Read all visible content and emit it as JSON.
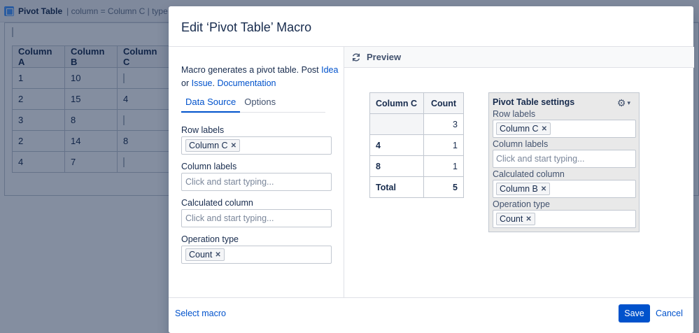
{
  "background": {
    "header": {
      "title": "Pivot Table",
      "params": "| column = Column C | type ="
    },
    "table": {
      "headers": [
        "Column A",
        "Column B",
        "Column C"
      ],
      "rows": [
        [
          "1",
          "10",
          ""
        ],
        [
          "2",
          "15",
          "4"
        ],
        [
          "3",
          "8",
          ""
        ],
        [
          "2",
          "14",
          "8"
        ],
        [
          "4",
          "7",
          ""
        ]
      ]
    }
  },
  "modal": {
    "title": "Edit ‘Pivot Table’ Macro",
    "description": {
      "text1": "Macro generates a pivot table. Post ",
      "link_idea": "Idea",
      "text2": "or ",
      "link_issue": "Issue",
      "text3": ". ",
      "link_docs": "Documentation"
    },
    "tabs": [
      "Data Source",
      "Options"
    ],
    "active_tab": "Data Source",
    "fields": {
      "row_labels": {
        "label": "Row labels",
        "chip": "Column C"
      },
      "column_labels": {
        "label": "Column labels",
        "placeholder": "Click and start typing..."
      },
      "calculated_column": {
        "label": "Calculated column",
        "placeholder": "Click and start typing..."
      },
      "operation_type": {
        "label": "Operation type",
        "chip": "Count"
      }
    },
    "preview": {
      "label": "Preview",
      "table": {
        "headers": [
          "Column C",
          "Count"
        ],
        "rows": [
          {
            "label": "",
            "value": "3"
          },
          {
            "label": "4",
            "value": "1"
          },
          {
            "label": "8",
            "value": "1"
          }
        ],
        "total": {
          "label": "Total",
          "value": "5"
        }
      },
      "settings": {
        "title": "Pivot Table settings",
        "row_labels": {
          "label": "Row labels",
          "chip": "Column C"
        },
        "column_labels": {
          "label": "Column labels",
          "placeholder": "Click and start typing..."
        },
        "calculated_column": {
          "label": "Calculated column",
          "chip": "Column B"
        },
        "operation_type": {
          "label": "Operation type",
          "chip": "Count"
        }
      }
    },
    "footer": {
      "select_macro": "Select macro",
      "save": "Save",
      "cancel": "Cancel"
    }
  },
  "colors": {
    "accent": "#0052cc",
    "overlay": "rgba(9,30,66,0.50)"
  }
}
